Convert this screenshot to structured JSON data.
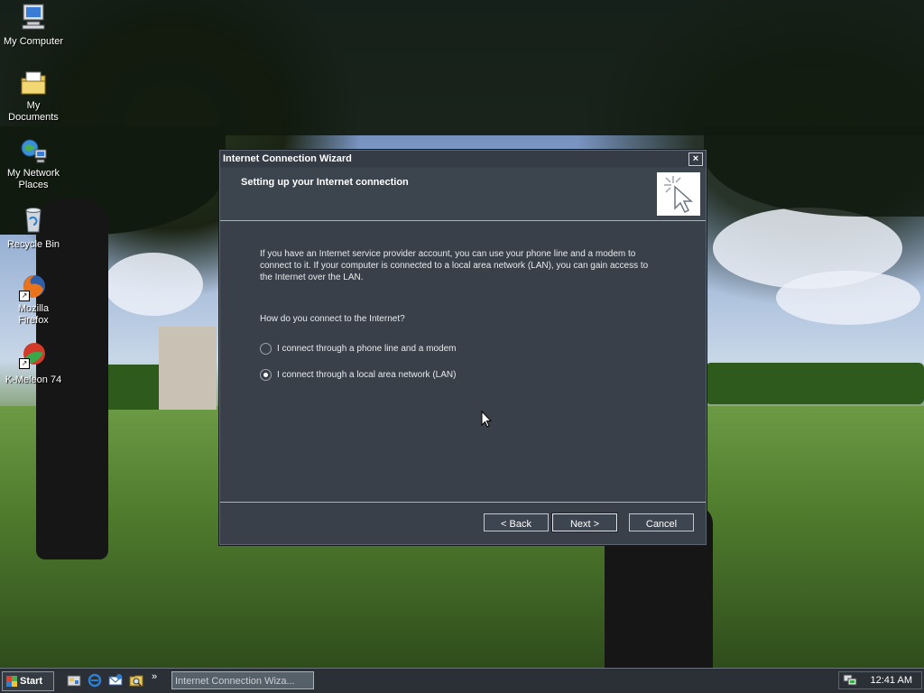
{
  "desktop": {
    "icons": [
      {
        "label": "My Computer"
      },
      {
        "label": "My Documents"
      },
      {
        "label": "My Network Places"
      },
      {
        "label": "Recycle Bin"
      },
      {
        "label": "Mozilla Firefox"
      },
      {
        "label": "K-Meleon 74"
      }
    ]
  },
  "wizard": {
    "title": "Internet Connection Wizard",
    "close_glyph": "×",
    "header_title": "Setting up your Internet connection",
    "intro": "If you have an Internet service provider account, you can use your phone line and a modem to connect to it. If your computer is connected to a local area network (LAN), you can gain access to the Internet over the LAN.",
    "question": "How do you connect to the Internet?",
    "options": [
      {
        "label": "I connect through a phone line and a modem",
        "checked": false
      },
      {
        "label": "I connect through a local area network (LAN)",
        "checked": true
      }
    ],
    "buttons": {
      "back": "< Back",
      "next": "Next >",
      "cancel": "Cancel"
    }
  },
  "taskbar": {
    "start_label": "Start",
    "chevron": "»",
    "task_label": "Internet Connection Wiza...",
    "clock": "12:41 AM"
  },
  "colors": {
    "window_bg": "#394049",
    "taskbar_bg": "#2b3036",
    "text_light": "#e8ebee"
  }
}
